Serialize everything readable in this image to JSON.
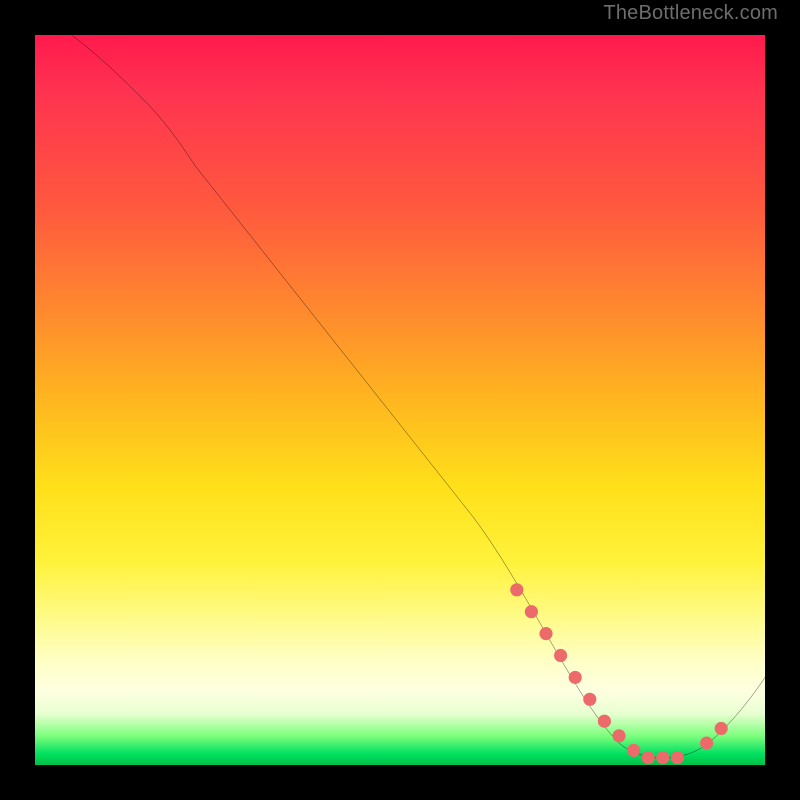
{
  "watermark": "TheBottleneck.com",
  "chart_data": {
    "type": "line",
    "title": "",
    "xlabel": "",
    "ylabel": "",
    "xlim": [
      0,
      100
    ],
    "ylim": [
      0,
      100
    ],
    "grid": false,
    "legend": false,
    "series": [
      {
        "name": "bottleneck-curve",
        "x": [
          5,
          10,
          15,
          20,
          30,
          40,
          50,
          60,
          65,
          70,
          75,
          80,
          85,
          90,
          95,
          100
        ],
        "values": [
          100,
          96,
          91,
          85,
          73,
          60,
          47,
          34,
          27,
          19,
          11,
          4,
          1,
          1,
          5,
          12
        ]
      }
    ],
    "markers": {
      "name": "highlight-dots",
      "color": "#ed6a6a",
      "x": [
        66,
        68,
        70,
        72,
        74,
        76,
        78,
        80,
        82,
        84,
        86,
        88,
        92,
        94
      ],
      "values": [
        24,
        21,
        18,
        15,
        12,
        9,
        6,
        4,
        2,
        1,
        1,
        1,
        3,
        5
      ]
    },
    "background_gradient": {
      "top": "#ff1a4d",
      "mid": "#ffe01a",
      "bottom": "#00c045"
    }
  }
}
